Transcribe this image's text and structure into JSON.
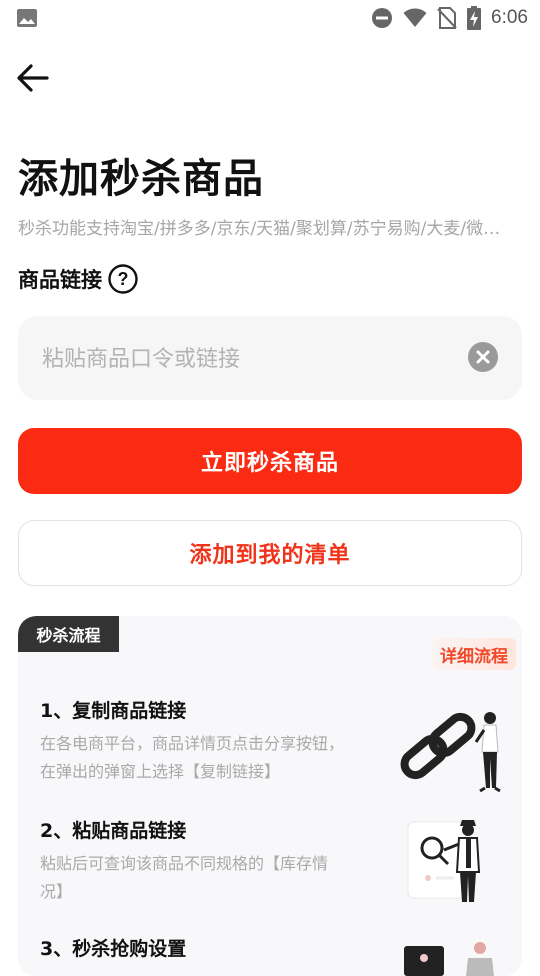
{
  "status_bar": {
    "time": "6:06"
  },
  "header": {
    "title": "添加秒杀商品",
    "subtitle": "秒杀功能支持淘宝/拼多多/京东/天猫/聚划算/苏宁易购/大麦/微…"
  },
  "form": {
    "link_label": "商品链接",
    "placeholder": "粘贴商品口令或链接",
    "value": ""
  },
  "buttons": {
    "seckill_now": "立即秒杀商品",
    "add_to_list": "添加到我的清单"
  },
  "flow": {
    "tag": "秒杀流程",
    "detail_link": "详细流程",
    "steps": [
      {
        "title": "1、复制商品链接",
        "desc": "在各电商平台，商品详情页点击分享按钮，在弹出的弹窗上选择【复制链接】"
      },
      {
        "title": "2、粘贴商品链接",
        "desc": "粘贴后可查询该商品不同规格的【库存情况】"
      },
      {
        "title": "3、秒杀抢购设置",
        "desc": ""
      }
    ]
  },
  "colors": {
    "primary": "#fa2b12",
    "accent_text": "#f0341b",
    "dark_tag": "#333333"
  }
}
